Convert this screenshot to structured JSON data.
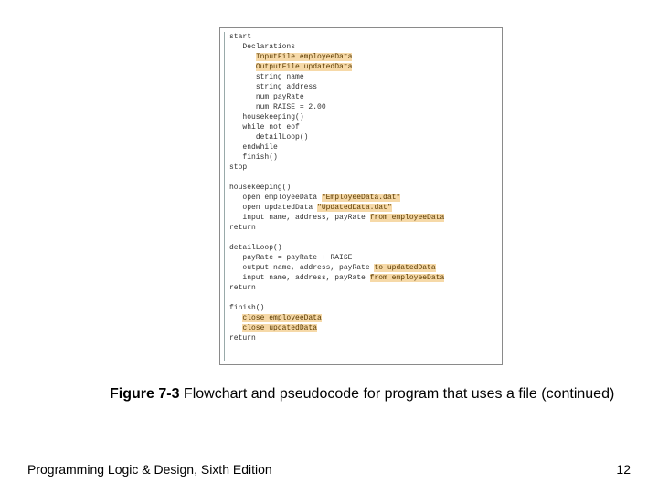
{
  "code": {
    "l1": "start",
    "l2": "Declarations",
    "l3": "InputFile employeeData",
    "l4": "OutputFile updatedData",
    "l5": "string name",
    "l6": "string address",
    "l7": "num payRate",
    "l8": "num RAISE = 2.00",
    "l9": "housekeeping()",
    "l10": "while not eof",
    "l11": "detailLoop()",
    "l12": "endwhile",
    "l13": "finish()",
    "l14": "stop",
    "l15": "housekeeping()",
    "l16a": "open employeeData ",
    "l16b": "\"EmployeeData.dat\"",
    "l17a": "open updatedData ",
    "l17b": "\"UpdatedData.dat\"",
    "l18a": "input name, address, payRate ",
    "l18b": "from employeeData",
    "l19": "return",
    "l20": "detailLoop()",
    "l21": "payRate = payRate + RAISE",
    "l22a": "output name, address, payRate ",
    "l22b": "to updatedData",
    "l23a": "input name, address, payRate ",
    "l23b": "from employeeData",
    "l24": "return",
    "l25": "finish()",
    "l26": "close employeeData",
    "l27": "close updatedData",
    "l28": "return"
  },
  "caption": {
    "bold": "Figure 7-3",
    "rest": " Flowchart and pseudocode for program that uses a file (continued)"
  },
  "footer": {
    "left": "Programming Logic & Design, Sixth Edition",
    "right": "12"
  }
}
